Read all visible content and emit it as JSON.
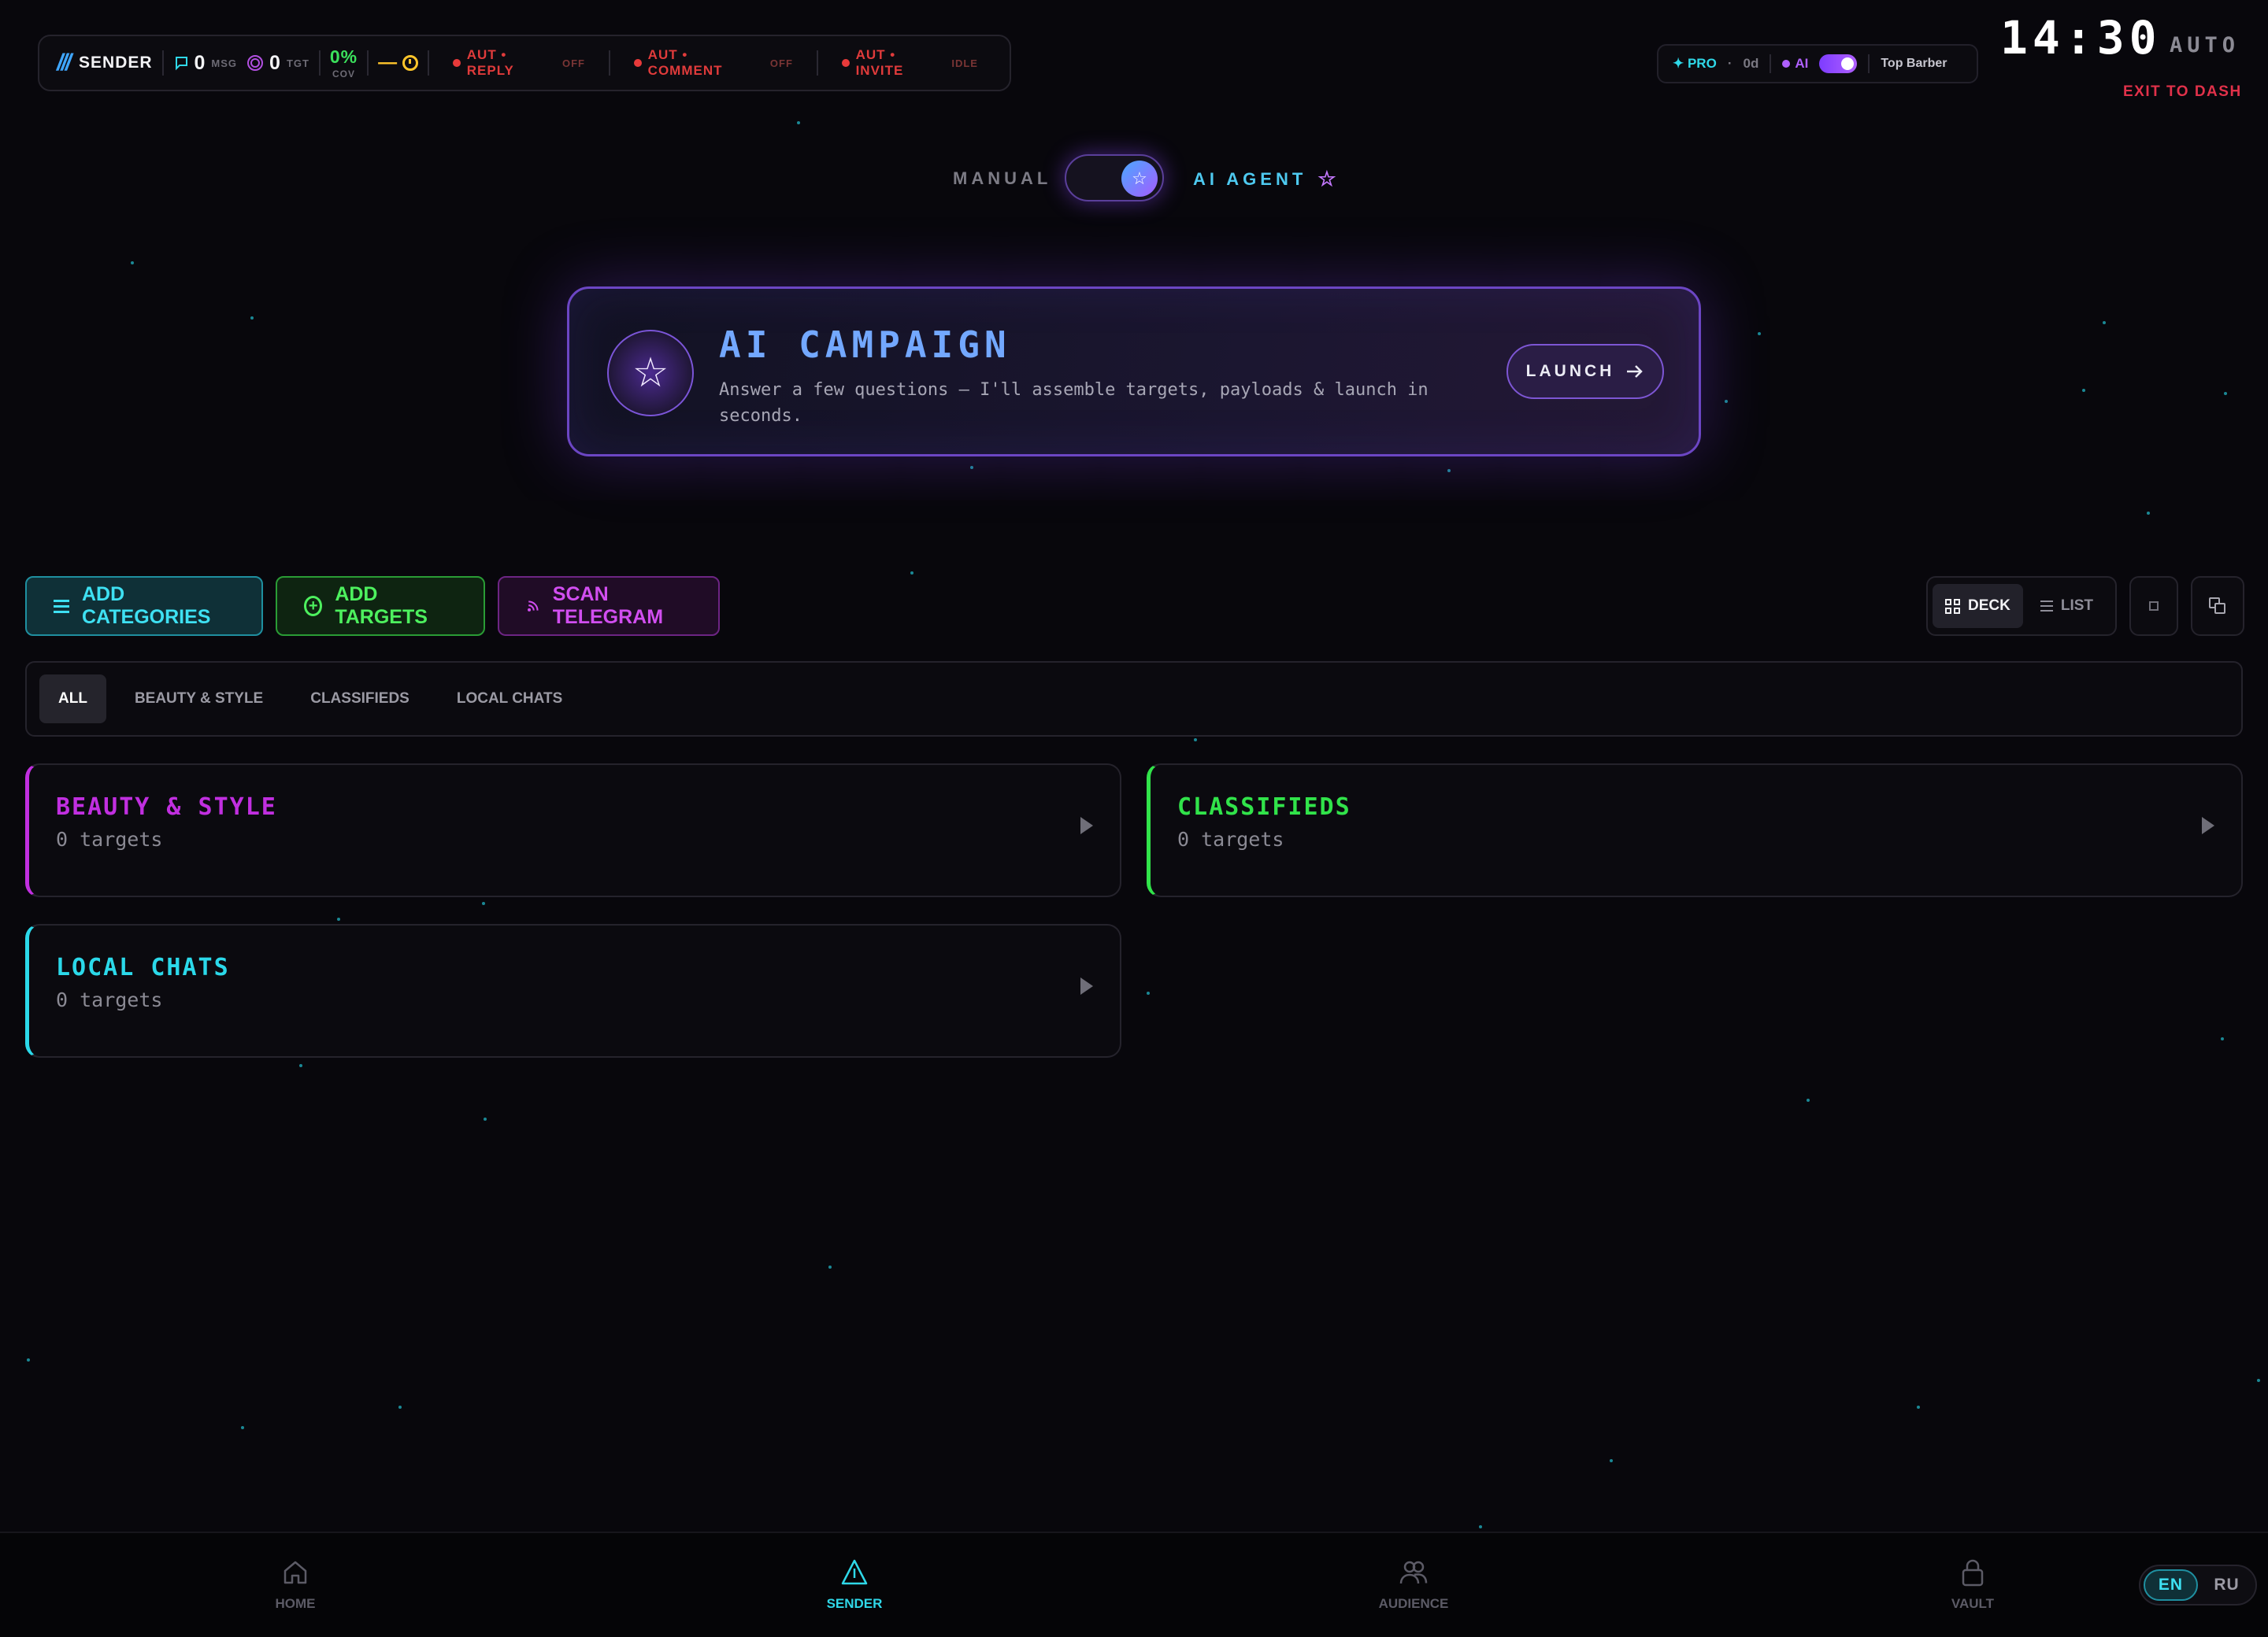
{
  "status_bar": {
    "brand": "SENDER",
    "msg_count": "0",
    "msg_unit": "MSG",
    "tgt_count": "0",
    "tgt_unit": "TGT",
    "coverage": "0%",
    "coverage_unit": "COV",
    "timer_value": "—",
    "auto_reply": {
      "label": "AUT • REPLY",
      "state": "OFF"
    },
    "auto_comment": {
      "label": "AUT • COMMENT",
      "state": "OFF"
    },
    "auto_invite": {
      "label": "AUT • INVITE",
      "state": "IDLE"
    }
  },
  "plan": {
    "tier": "✦ PRO",
    "days": "0d",
    "ai_label": "AI",
    "ai_enabled": true,
    "shop_name": "Top Barber"
  },
  "clock": "14:30",
  "mode_badge": "AUTO",
  "exit_link": "EXIT TO DASH",
  "mode_switch": {
    "left_label": "MANUAL",
    "right_label": "AI AGENT",
    "selected": "AI AGENT"
  },
  "campaign": {
    "title": "AI CAMPAIGN",
    "description": "Answer a few questions — I'll assemble targets, payloads & launch in seconds.",
    "launch_label": "LAUNCH"
  },
  "actions": {
    "add_categories": "ADD CATEGORIES",
    "add_targets": "ADD TARGETS",
    "scan_telegram": "SCAN TELEGRAM"
  },
  "view_switch": {
    "deck": "DECK",
    "list": "LIST",
    "selected": "DECK"
  },
  "filters": [
    "ALL",
    "BEAUTY & STYLE",
    "CLASSIFIEDS",
    "LOCAL CHATS"
  ],
  "categories": [
    {
      "name": "BEAUTY & STYLE",
      "count": "0 targets",
      "color": "#c12fe0"
    },
    {
      "name": "CLASSIFIEDS",
      "count": "0 targets",
      "color": "#31e34a"
    },
    {
      "name": "LOCAL CHATS",
      "count": "0 targets",
      "color": "#2bd9ea"
    }
  ],
  "nav": {
    "home": "HOME",
    "sender": "SENDER",
    "audience": "AUDIENCE",
    "vault": "VAULT",
    "active": "SENDER"
  },
  "language": {
    "en": "EN",
    "ru": "RU",
    "selected": "EN"
  },
  "colors": {
    "accent_cyan": "#2fd8e8",
    "accent_green": "#3be15c",
    "accent_magenta": "#c12fe0",
    "accent_purple": "#7d56d4",
    "alert_red": "#e03b3b",
    "background": "#08070c"
  }
}
